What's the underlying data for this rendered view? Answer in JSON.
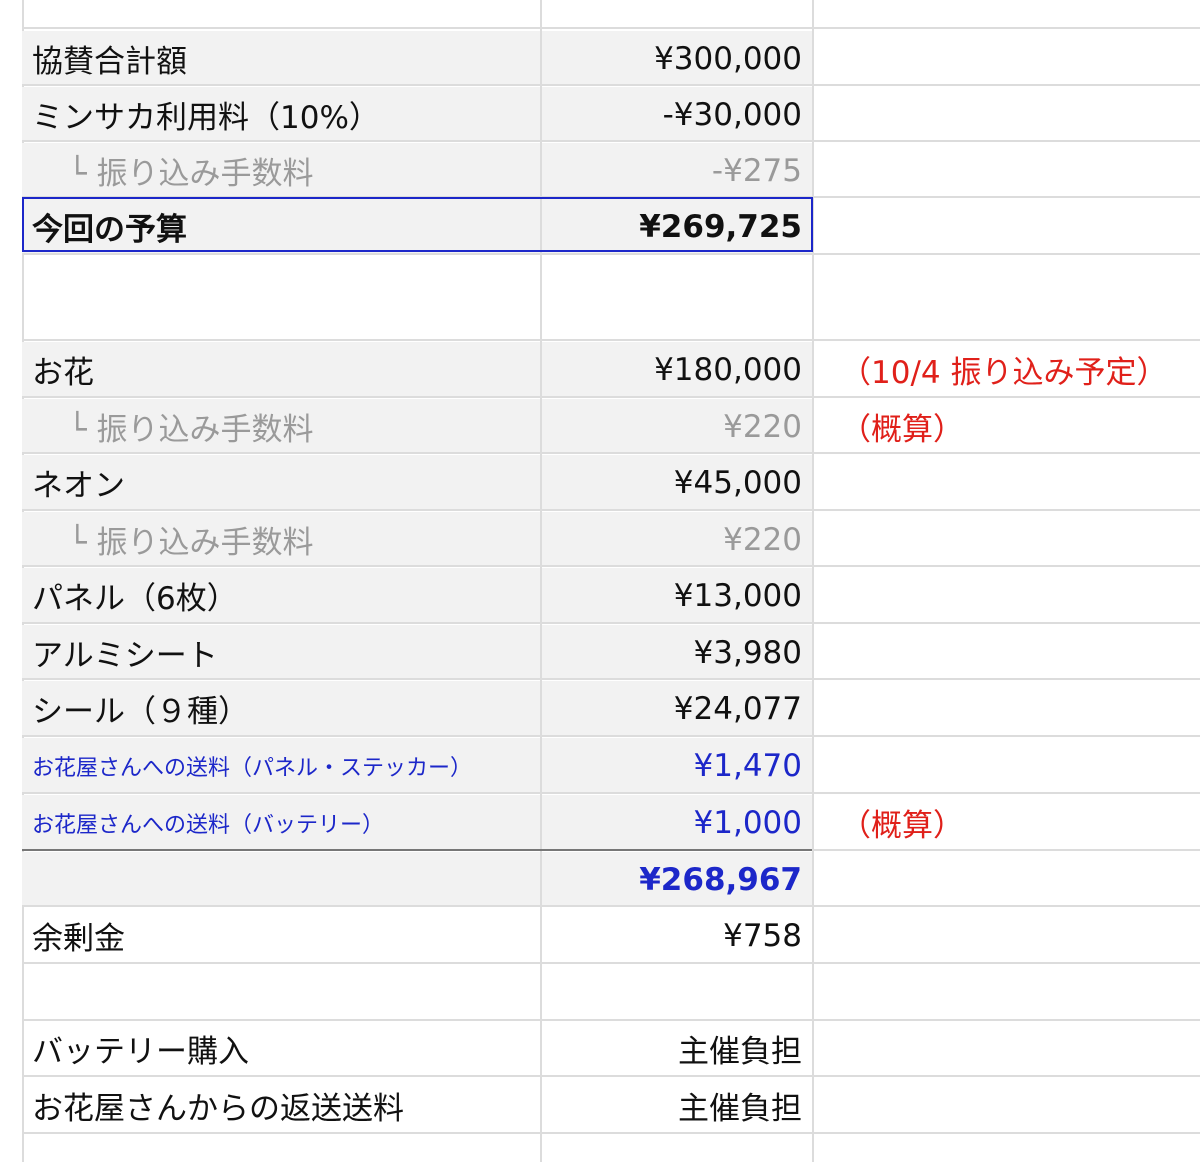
{
  "rows": [
    {
      "label": "",
      "value": "",
      "note": ""
    },
    {
      "label": "協賛合計額",
      "value": "¥300,000",
      "note": ""
    },
    {
      "label": "ミンサカ利用料（10%）",
      "value": "-¥30,000",
      "note": ""
    },
    {
      "label": "└ 振り込み手数料",
      "value": "-¥275",
      "note": ""
    },
    {
      "label": "今回の予算",
      "value": "¥269,725",
      "note": ""
    },
    {
      "label": "",
      "value": "",
      "note": ""
    },
    {
      "label": "お花",
      "value": "¥180,000",
      "note": "（10/4 振り込み予定）"
    },
    {
      "label": "└ 振り込み手数料",
      "value": "¥220",
      "note": "（概算）"
    },
    {
      "label": "ネオン",
      "value": "¥45,000",
      "note": ""
    },
    {
      "label": "└ 振り込み手数料",
      "value": "¥220",
      "note": ""
    },
    {
      "label": "パネル（6枚）",
      "value": "¥13,000",
      "note": ""
    },
    {
      "label": "アルミシート",
      "value": "¥3,980",
      "note": ""
    },
    {
      "label": "シール（９種）",
      "value": "¥24,077",
      "note": ""
    },
    {
      "label": "お花屋さんへの送料（パネル・ステッカー）",
      "value": "¥1,470",
      "note": ""
    },
    {
      "label": "お花屋さんへの送料（バッテリー）",
      "value": "¥1,000",
      "note": "（概算）"
    },
    {
      "label": "",
      "value": "¥268,967",
      "note": ""
    },
    {
      "label": "余剰金",
      "value": "¥758",
      "note": ""
    },
    {
      "label": "",
      "value": "",
      "note": ""
    },
    {
      "label": "バッテリー購入",
      "value": "主催負担",
      "note": ""
    },
    {
      "label": "お花屋さんからの返送送料",
      "value": "主催負担",
      "note": ""
    }
  ],
  "colors": {
    "gridline": "#dcdcdc",
    "shade": "#f2f2f2",
    "blue_text": "#1c27c9",
    "red_note": "#e0201a",
    "gray_text": "#9a9a9a"
  }
}
